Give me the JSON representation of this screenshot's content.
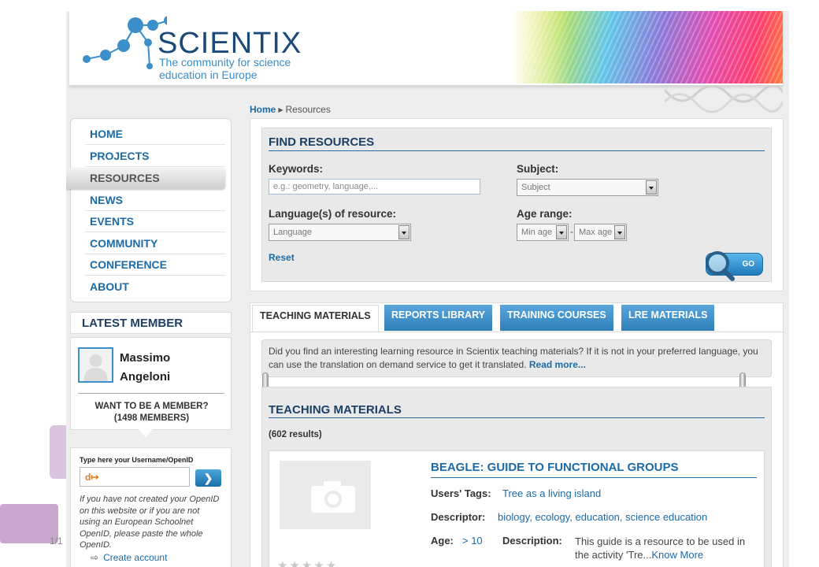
{
  "page_number": "1/1",
  "logo": {
    "title": "SCIENTIX",
    "tagline": "The community for science education in Europe"
  },
  "breadcrumb": {
    "home": "Home",
    "current": "Resources"
  },
  "nav": {
    "items": [
      {
        "label": "HOME",
        "active": false
      },
      {
        "label": "PROJECTS",
        "active": false
      },
      {
        "label": "RESOURCES",
        "active": true
      },
      {
        "label": "NEWS",
        "active": false
      },
      {
        "label": "EVENTS",
        "active": false
      },
      {
        "label": "COMMUNITY",
        "active": false
      },
      {
        "label": "CONFERENCE",
        "active": false
      },
      {
        "label": "ABOUT",
        "active": false
      }
    ]
  },
  "latest_member": {
    "heading": "LATEST MEMBER",
    "name": "Massimo Angeloni",
    "want_member": "WANT TO BE A MEMBER?",
    "member_count": "(1498 MEMBERS)"
  },
  "login": {
    "label": "Type here your Username/OpenID",
    "note": "If you have not created your OpenID on this website or if you are not using an European Schoolnet OpenID, please paste the whole OpenID.",
    "create_account": "Create account",
    "create_prefix": "⇨"
  },
  "find": {
    "title": "FIND RESOURCES",
    "keywords_label": "Keywords:",
    "keywords_placeholder": "e.g.: geometry, language,...",
    "subject_label": "Subject:",
    "subject_value": "Subject",
    "language_label": "Language(s) of resource:",
    "language_value": "Language",
    "age_label": "Age range:",
    "min_age": "Min age",
    "max_age": "Max age",
    "age_sep": "-",
    "reset": "Reset",
    "go": "GO"
  },
  "tabs": [
    {
      "label": "TEACHING MATERIALS",
      "active": true
    },
    {
      "label": "REPORTS LIBRARY",
      "active": false
    },
    {
      "label": "TRAINING COURSES",
      "active": false
    },
    {
      "label": "LRE MATERIALS",
      "active": false
    }
  ],
  "info": {
    "text": "Did you find an interesting learning resource in Scientix teaching materials? If it is not in your preferred language, you can use the translation on demand service to get it translated.",
    "read_more": "Read more..."
  },
  "teaching": {
    "title": "TEACHING MATERIALS",
    "count": "(602 results)",
    "result": {
      "title": "BEAGLE: GUIDE TO FUNCTIONAL GROUPS",
      "tags_label": "Users' Tags:",
      "tags_value": "Tree as a living island",
      "descriptor_label": "Descriptor:",
      "descriptor_value": "biology, ecology, education, science education",
      "age_label": "Age:",
      "age_value": "> 10",
      "description_label": "Description:",
      "description_text": "This guide is a resource to be used in the activity 'Tre...",
      "know_more": "Know More"
    }
  },
  "colors": {
    "brand_blue": "#1c6aa6",
    "heading_navy": "#1c3f66",
    "tab_blue": "#3f8fc6"
  }
}
